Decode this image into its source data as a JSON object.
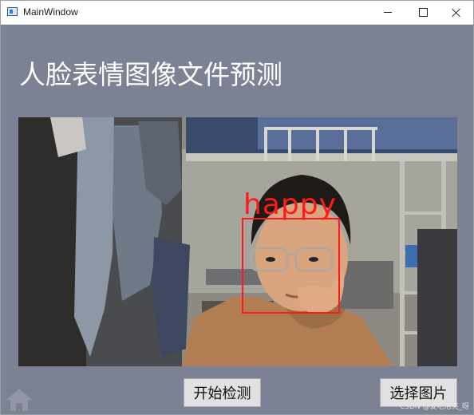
{
  "window": {
    "title": "MainWindow",
    "app_icon": "window-app-icon",
    "controls": [
      "minimize-icon",
      "maximize-icon",
      "close-icon"
    ]
  },
  "heading": "人脸表情图像文件预测",
  "prediction": {
    "label": "happy",
    "box_color": "#ff1a1a"
  },
  "buttons": {
    "start_detect": "开始检测",
    "select_image": "选择图片"
  },
  "watermark": "CSDN @爱吃泡芙_呀",
  "colors": {
    "background": "#7c8193",
    "heading": "#ffffff"
  }
}
